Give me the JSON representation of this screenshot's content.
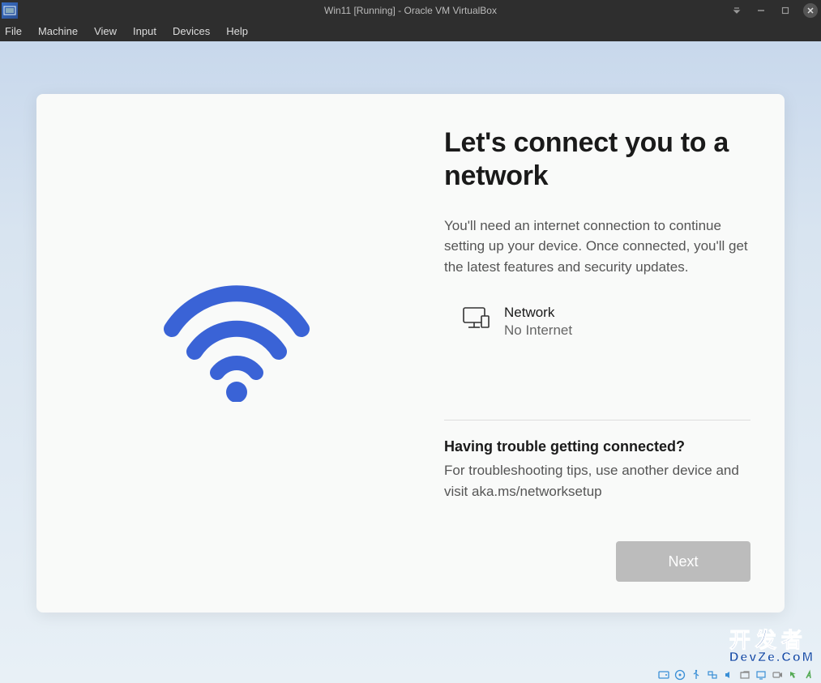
{
  "window": {
    "title": "Win11 [Running] - Oracle VM VirtualBox"
  },
  "menubar": {
    "items": [
      "File",
      "Machine",
      "View",
      "Input",
      "Devices",
      "Help"
    ]
  },
  "oobe": {
    "heading": "Let's connect you to a network",
    "subtext": "You'll need an internet connection to continue setting up your device. Once connected, you'll get the latest features and security updates.",
    "network": {
      "title": "Network",
      "status": "No Internet"
    },
    "trouble": {
      "heading": "Having trouble getting connected?",
      "text": "For troubleshooting tips, use another device and visit aka.ms/networksetup"
    },
    "next_label": "Next"
  },
  "watermark": {
    "top": "开发者",
    "bottom": "DevZe.CoM"
  },
  "colors": {
    "wifi_accent": "#3a63d6",
    "card_bg": "#f9faf9",
    "next_disabled_bg": "#bcbcbc"
  }
}
